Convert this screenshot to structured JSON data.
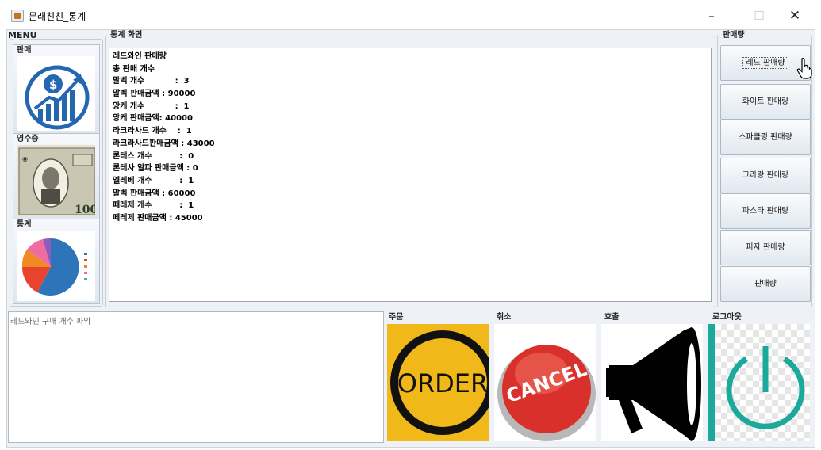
{
  "window": {
    "title": "문래친친_통계"
  },
  "menu": {
    "label": "MENU",
    "items": [
      {
        "label": "판매"
      },
      {
        "label": "영수증"
      },
      {
        "label": "통계"
      }
    ]
  },
  "stats_panel": {
    "legend": "통계 화면",
    "lines": [
      "레드와인 판매량",
      "총 판매 개수",
      "말벡 개수           :  3",
      "말벡 판매금액 : 90000",
      "앙케 개수           :  1",
      "앙케 판매금액: 40000",
      "라크라사드 개수    :  1",
      "라크라사드판매금액 : 43000",
      "론테스 개수          :  0",
      "론테사 알파 판매금액 : 0",
      "엘레베 개수          :  1",
      "말벡 판매금액 : 60000",
      "페레제 개수          :  1",
      "페레제 판매금액 : 45000"
    ]
  },
  "sales_panel": {
    "legend": "판매량",
    "buttons": [
      {
        "label": "레드 판매량"
      },
      {
        "label": "화이트 판매량"
      },
      {
        "label": "스파클링 판매량"
      },
      {
        "label": "그라랑 판매량"
      },
      {
        "label": "파스타 판매량"
      },
      {
        "label": "피자 판매량"
      },
      {
        "label": "판매량"
      }
    ]
  },
  "bottom": {
    "text_area_placeholder": "레드와인 구매 개수 파악",
    "actions": [
      {
        "caption": "주문",
        "image_text": "ORDER"
      },
      {
        "caption": "취소",
        "image_text": "CANCEL"
      },
      {
        "caption": "호출"
      },
      {
        "caption": "로그아웃"
      }
    ]
  },
  "receipt_bill": {
    "text": "100"
  },
  "colors": {
    "order_yellow": "#f0b818",
    "cancel_red": "#d9302c",
    "power_teal": "#1aa99a",
    "pie_blue": "#2e74b8"
  },
  "icons": [
    "app-icon",
    "sales-chart-icon",
    "money-bill-image",
    "pie-chart-image",
    "order-icon",
    "cancel-icon",
    "megaphone-icon",
    "power-icon",
    "hand-cursor-icon"
  ]
}
